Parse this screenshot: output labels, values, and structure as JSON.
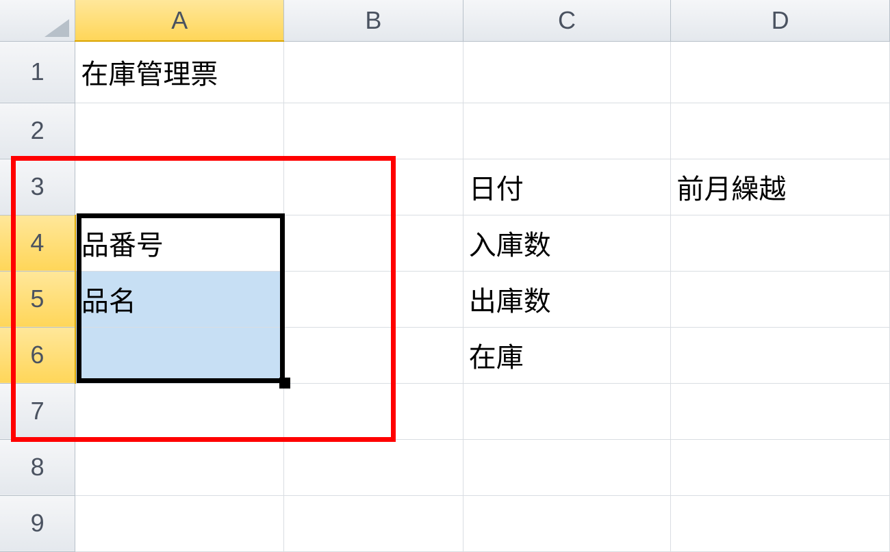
{
  "columns": [
    "A",
    "B",
    "C",
    "D"
  ],
  "rows": [
    "1",
    "2",
    "3",
    "4",
    "5",
    "6",
    "7",
    "8",
    "9"
  ],
  "cells": {
    "A1": "在庫管理票",
    "A4": "品番号",
    "A5": "品名",
    "C3": "日付",
    "C4": "入庫数",
    "C5": "出庫数",
    "C6": "在庫",
    "D3": "前月繰越"
  },
  "selection": {
    "range": "A4:A6",
    "anchor": "A4"
  },
  "active_column": "A",
  "active_rows": [
    "4",
    "5",
    "6"
  ]
}
